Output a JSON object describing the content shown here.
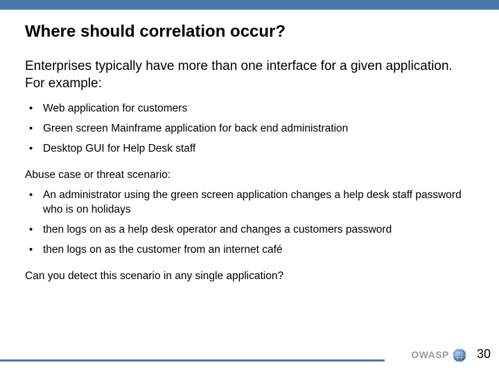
{
  "title": "Where should correlation occur?",
  "intro": "Enterprises typically have more than one interface for a given application. For example:",
  "examples": [
    "Web application for customers",
    "Green screen Mainframe application for back end administration",
    "Desktop GUI for Help Desk staff"
  ],
  "scenario_heading": "Abuse case or threat scenario:",
  "scenario": [
    "An administrator using the green screen application changes a help desk staff password who is on holidays",
    "then logs on as a help desk operator and changes a customers password",
    "then logs on as the customer from an internet café"
  ],
  "closing": "Can you detect this scenario in any single application?",
  "footer": {
    "org": "OWASP",
    "page": "30"
  }
}
